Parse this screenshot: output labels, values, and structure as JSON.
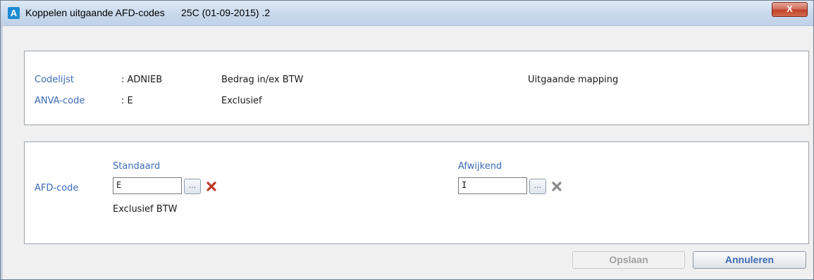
{
  "window": {
    "app_icon_letter": "A",
    "title": "Koppelen uitgaande AFD-codes",
    "version": "25C (01-09-2015) .2",
    "close_label": "X"
  },
  "info_panel": {
    "codelijst_label": "Codelijst",
    "codelijst_value": ": ADNIEB",
    "codelijst_desc": "Bedrag in/ex BTW",
    "mapping_label": "Uitgaande mapping",
    "anva_label": "ANVA-code",
    "anva_value": ": E",
    "anva_desc": "Exclusief"
  },
  "afd_panel": {
    "afd_label": "AFD-code",
    "standaard_header": "Standaard",
    "standaard_value": "E",
    "standaard_desc": "Exclusief BTW",
    "afwijkend_header": "Afwijkend",
    "afwijkend_value": "I",
    "browse_label": "...",
    "delete_icon_color_active": "#c0392b",
    "delete_icon_color_inactive": "#8a8a8a"
  },
  "buttons": {
    "save_label": "Opslaan",
    "cancel_label": "Annuleren"
  }
}
